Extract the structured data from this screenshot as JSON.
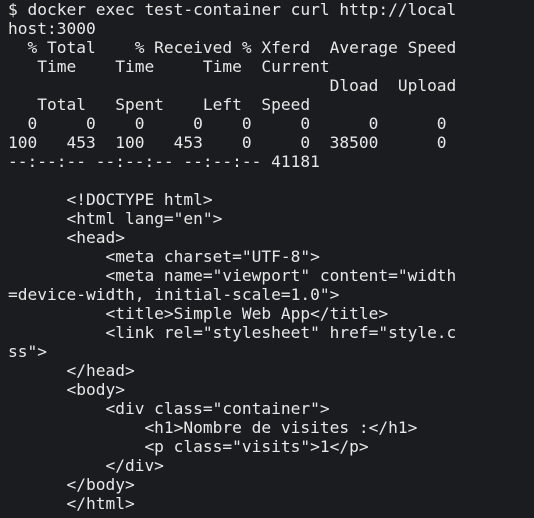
{
  "terminal": {
    "lines": [
      "$ docker exec test-container curl http://local",
      "host:3000",
      "  % Total    % Received % Xferd  Average Speed",
      "   Time    Time     Time  Current",
      "                                 Dload  Upload",
      "   Total   Spent    Left  Speed",
      "  0     0    0     0    0     0      0      0",
      "100   453  100   453    0     0  38500      0",
      "--:--:-- --:--:-- --:--:-- 41181",
      "",
      "      <!DOCTYPE html>",
      "      <html lang=\"en\">",
      "      <head>",
      "          <meta charset=\"UTF-8\">",
      "          <meta name=\"viewport\" content=\"width",
      "=device-width, initial-scale=1.0\">",
      "          <title>Simple Web App</title>",
      "          <link rel=\"stylesheet\" href=\"style.c",
      "ss\">",
      "      </head>",
      "      <body>",
      "          <div class=\"container\">",
      "              <h1>Nombre de visites :</h1>",
      "              <p class=\"visits\">1</p>",
      "          </div>",
      "      </body>",
      "      </html>"
    ]
  }
}
